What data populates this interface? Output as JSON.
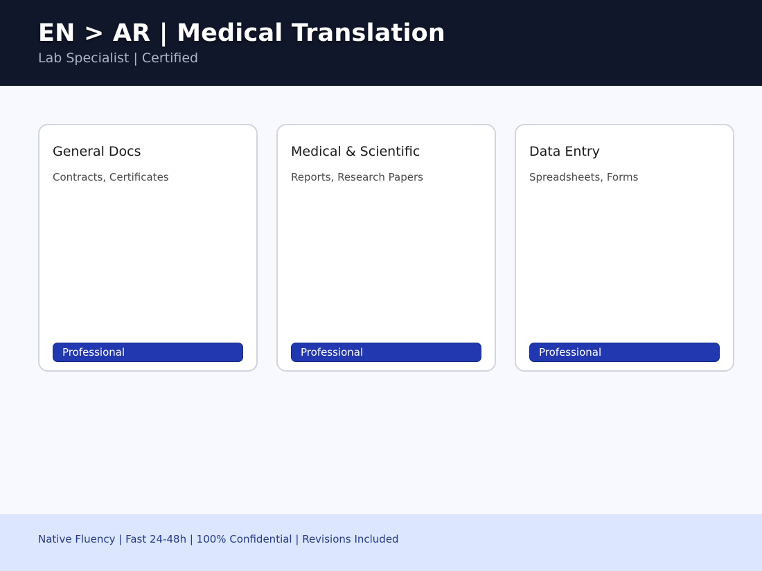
{
  "header": {
    "title": "EN > AR | Medical Translation",
    "subtitle": "Lab Specialist | Certified"
  },
  "cards": [
    {
      "title": "General Docs",
      "description": "Contracts, Certificates",
      "badge": "Professional"
    },
    {
      "title": "Medical & Scientific",
      "description": "Reports, Research Papers",
      "badge": "Professional"
    },
    {
      "title": "Data Entry",
      "description": "Spreadsheets, Forms",
      "badge": "Professional"
    }
  ],
  "footer": {
    "text": "Native Fluency | Fast 24-48h | 100% Confidential | Revisions Included"
  },
  "colors": {
    "header_bg": "#11172b",
    "page_bg": "#f8f8ff",
    "badge_bg": "#2238b0",
    "footer_bg": "#dce6fe",
    "footer_text": "#253a88"
  }
}
